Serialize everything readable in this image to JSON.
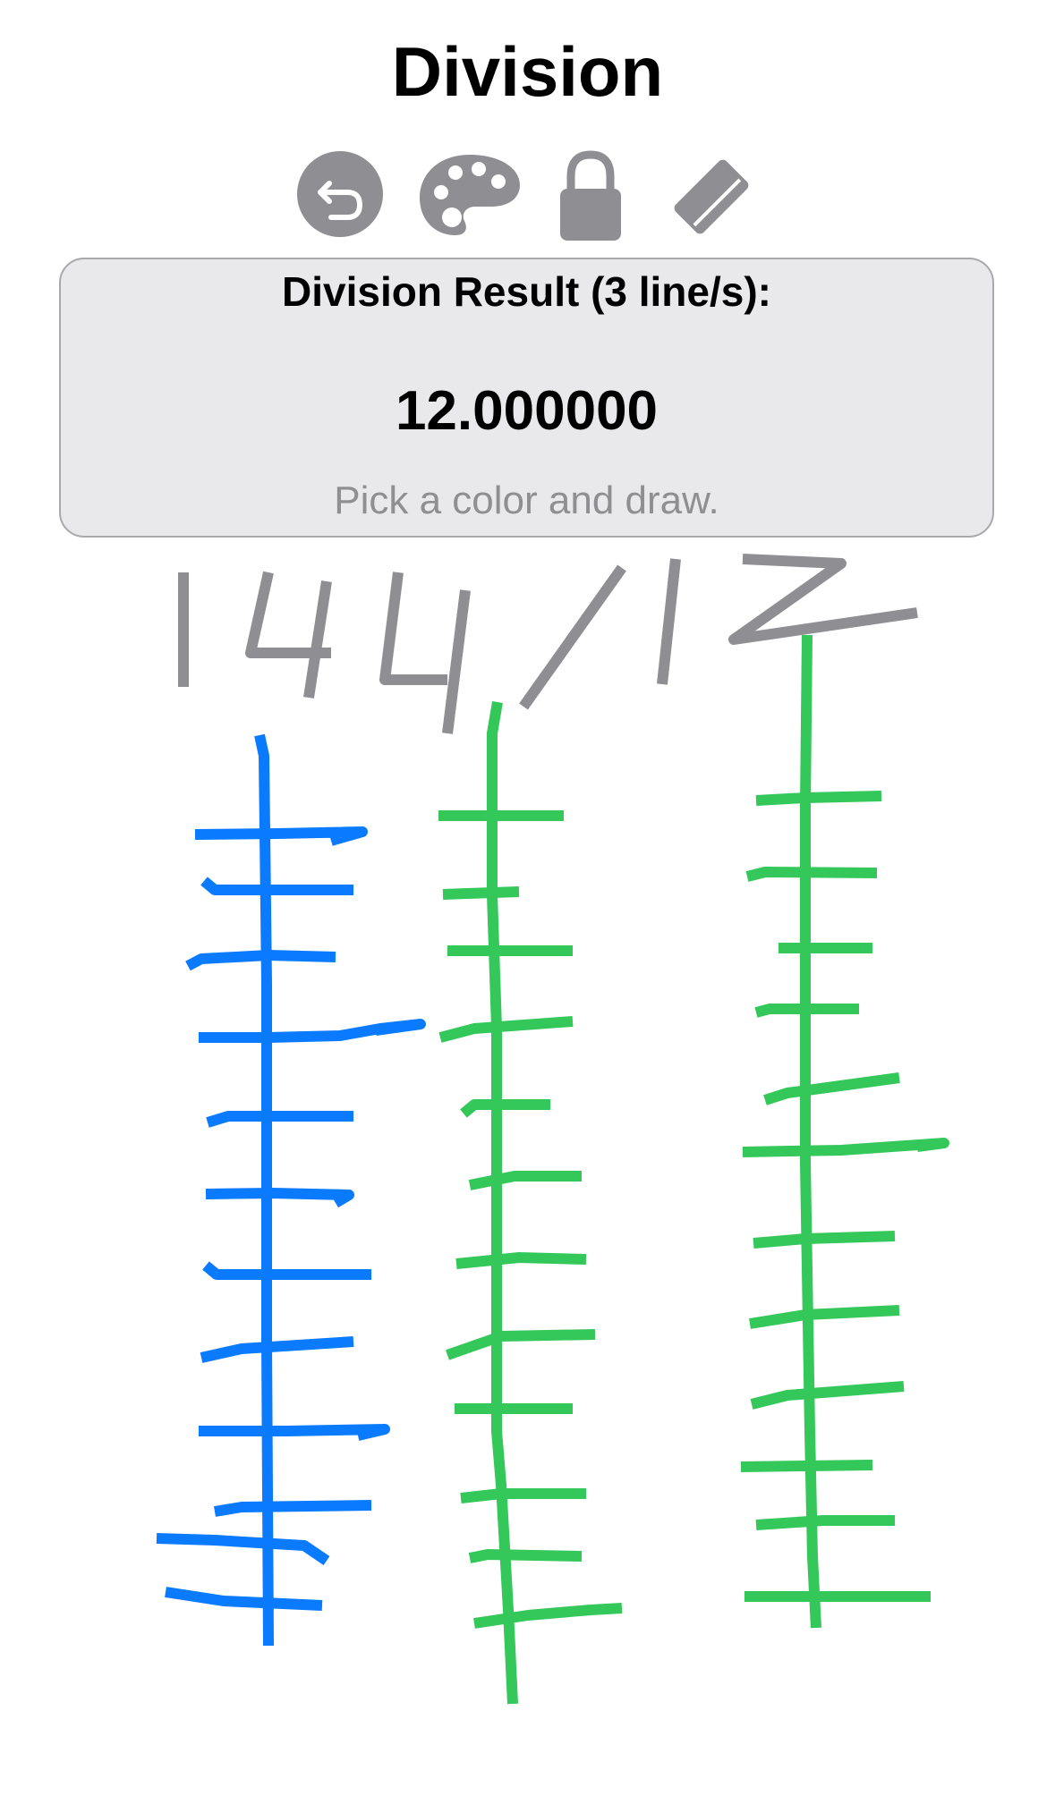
{
  "header": {
    "title": "Division"
  },
  "toolbar": {
    "tools": [
      {
        "name": "undo",
        "icon": "undo-icon"
      },
      {
        "name": "color-palette",
        "icon": "palette-icon"
      },
      {
        "name": "lock",
        "icon": "lock-icon"
      },
      {
        "name": "eraser",
        "icon": "eraser-icon"
      }
    ]
  },
  "result": {
    "heading": "Division Result (3 line/s):",
    "value": "12.000000",
    "hint": "Pick a color and draw."
  },
  "colors": {
    "ink_gray": "#8e8e93",
    "stroke_blue": "#0a7aff",
    "stroke_green": "#34c759",
    "icon_gray": "#8e8e93",
    "panel_bg": "#e9e9eb"
  }
}
